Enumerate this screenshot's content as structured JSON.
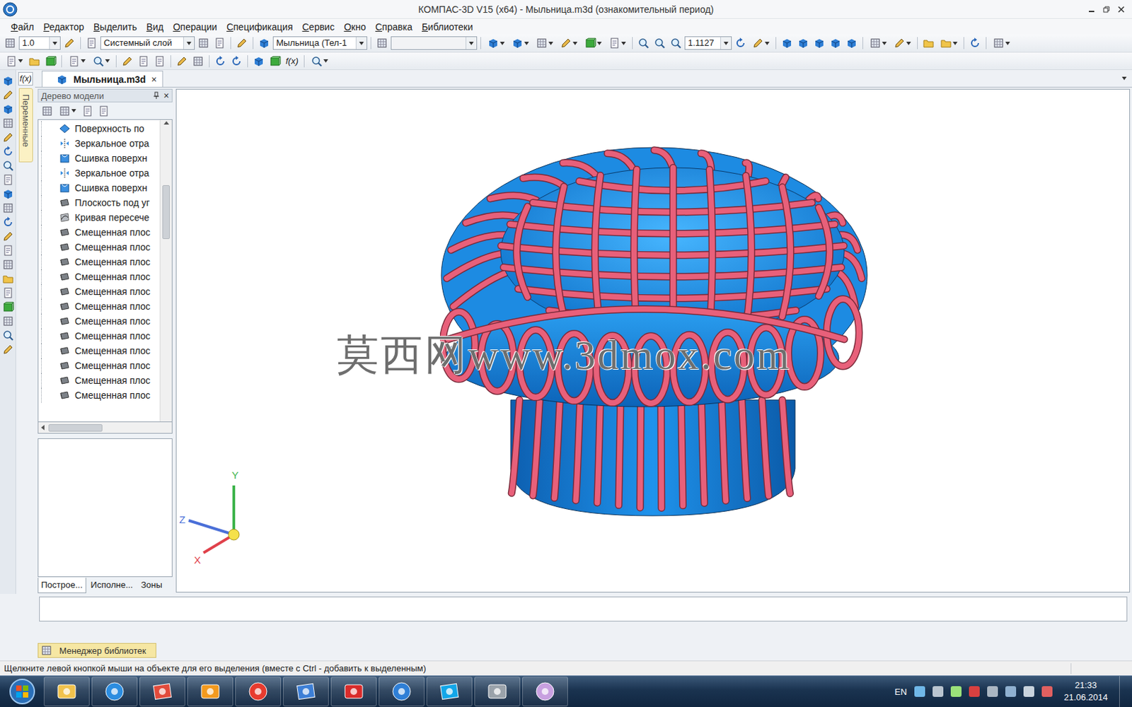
{
  "window": {
    "title": "КОМПАС-3D V15 (x64) - Мыльница.m3d (ознакомительный период)"
  },
  "menu": [
    {
      "label": "Файл"
    },
    {
      "label": "Редактор"
    },
    {
      "label": "Выделить"
    },
    {
      "label": "Вид"
    },
    {
      "label": "Операции"
    },
    {
      "label": "Спецификация"
    },
    {
      "label": "Сервис"
    },
    {
      "label": "Окно"
    },
    {
      "label": "Справка"
    },
    {
      "label": "Библиотеки"
    }
  ],
  "toolbar": {
    "scale": "1.0",
    "layer": "Системный слой",
    "part": "Мыльница (Тел-1",
    "style": "",
    "zoom": "1.1127",
    "formula_button": "f(x)"
  },
  "side_panel": {
    "formula_button": "f(x)",
    "variables_tab": "Переменные"
  },
  "document_tab": {
    "label": "Мыльница.m3d",
    "close": "×",
    "selected": true
  },
  "tree": {
    "title": "Дерево модели",
    "close": "×",
    "items": [
      {
        "label": "Поверхность по",
        "kind": "surface"
      },
      {
        "label": "Зеркальное отра",
        "kind": "mirror"
      },
      {
        "label": "Сшивка поверхн",
        "kind": "stitch"
      },
      {
        "label": "Зеркальное отра",
        "kind": "mirror"
      },
      {
        "label": "Сшивка поверхн",
        "kind": "stitch"
      },
      {
        "label": "Плоскость под уг",
        "kind": "plane"
      },
      {
        "label": "Кривая пересече",
        "kind": "curve"
      },
      {
        "label": "Смещенная плос",
        "kind": "plane"
      },
      {
        "label": "Смещенная плос",
        "kind": "plane"
      },
      {
        "label": "Смещенная плос",
        "kind": "plane"
      },
      {
        "label": "Смещенная плос",
        "kind": "plane"
      },
      {
        "label": "Смещенная плос",
        "kind": "plane"
      },
      {
        "label": "Смещенная плос",
        "kind": "plane"
      },
      {
        "label": "Смещенная плос",
        "kind": "plane"
      },
      {
        "label": "Смещенная плос",
        "kind": "plane"
      },
      {
        "label": "Смещенная плос",
        "kind": "plane"
      },
      {
        "label": "Смещенная плос",
        "kind": "plane"
      },
      {
        "label": "Смещенная плос",
        "kind": "plane"
      },
      {
        "label": "Смещенная плос",
        "kind": "plane"
      }
    ],
    "tabs": [
      {
        "label": "Построе...",
        "selected": true
      },
      {
        "label": "Исполне...",
        "selected": false
      },
      {
        "label": "Зоны",
        "selected": false
      }
    ]
  },
  "viewport": {
    "watermark": "莫西网www.3dmox.com",
    "axes": [
      {
        "label": "Y",
        "color": "#3cb34a"
      },
      {
        "label": "Z",
        "color": "#4a6fd8"
      },
      {
        "label": "X",
        "color": "#e0404a"
      }
    ]
  },
  "command_line": {
    "value": ""
  },
  "library_manager": {
    "label": "Менеджер библиотек"
  },
  "status_bar": {
    "text": "Щелкните левой кнопкой мыши на объекте для его выделения (вместе с Ctrl - добавить к выделенным)"
  },
  "taskbar": {
    "language": "EN",
    "time": "21:33",
    "date": "21.06.2014"
  }
}
